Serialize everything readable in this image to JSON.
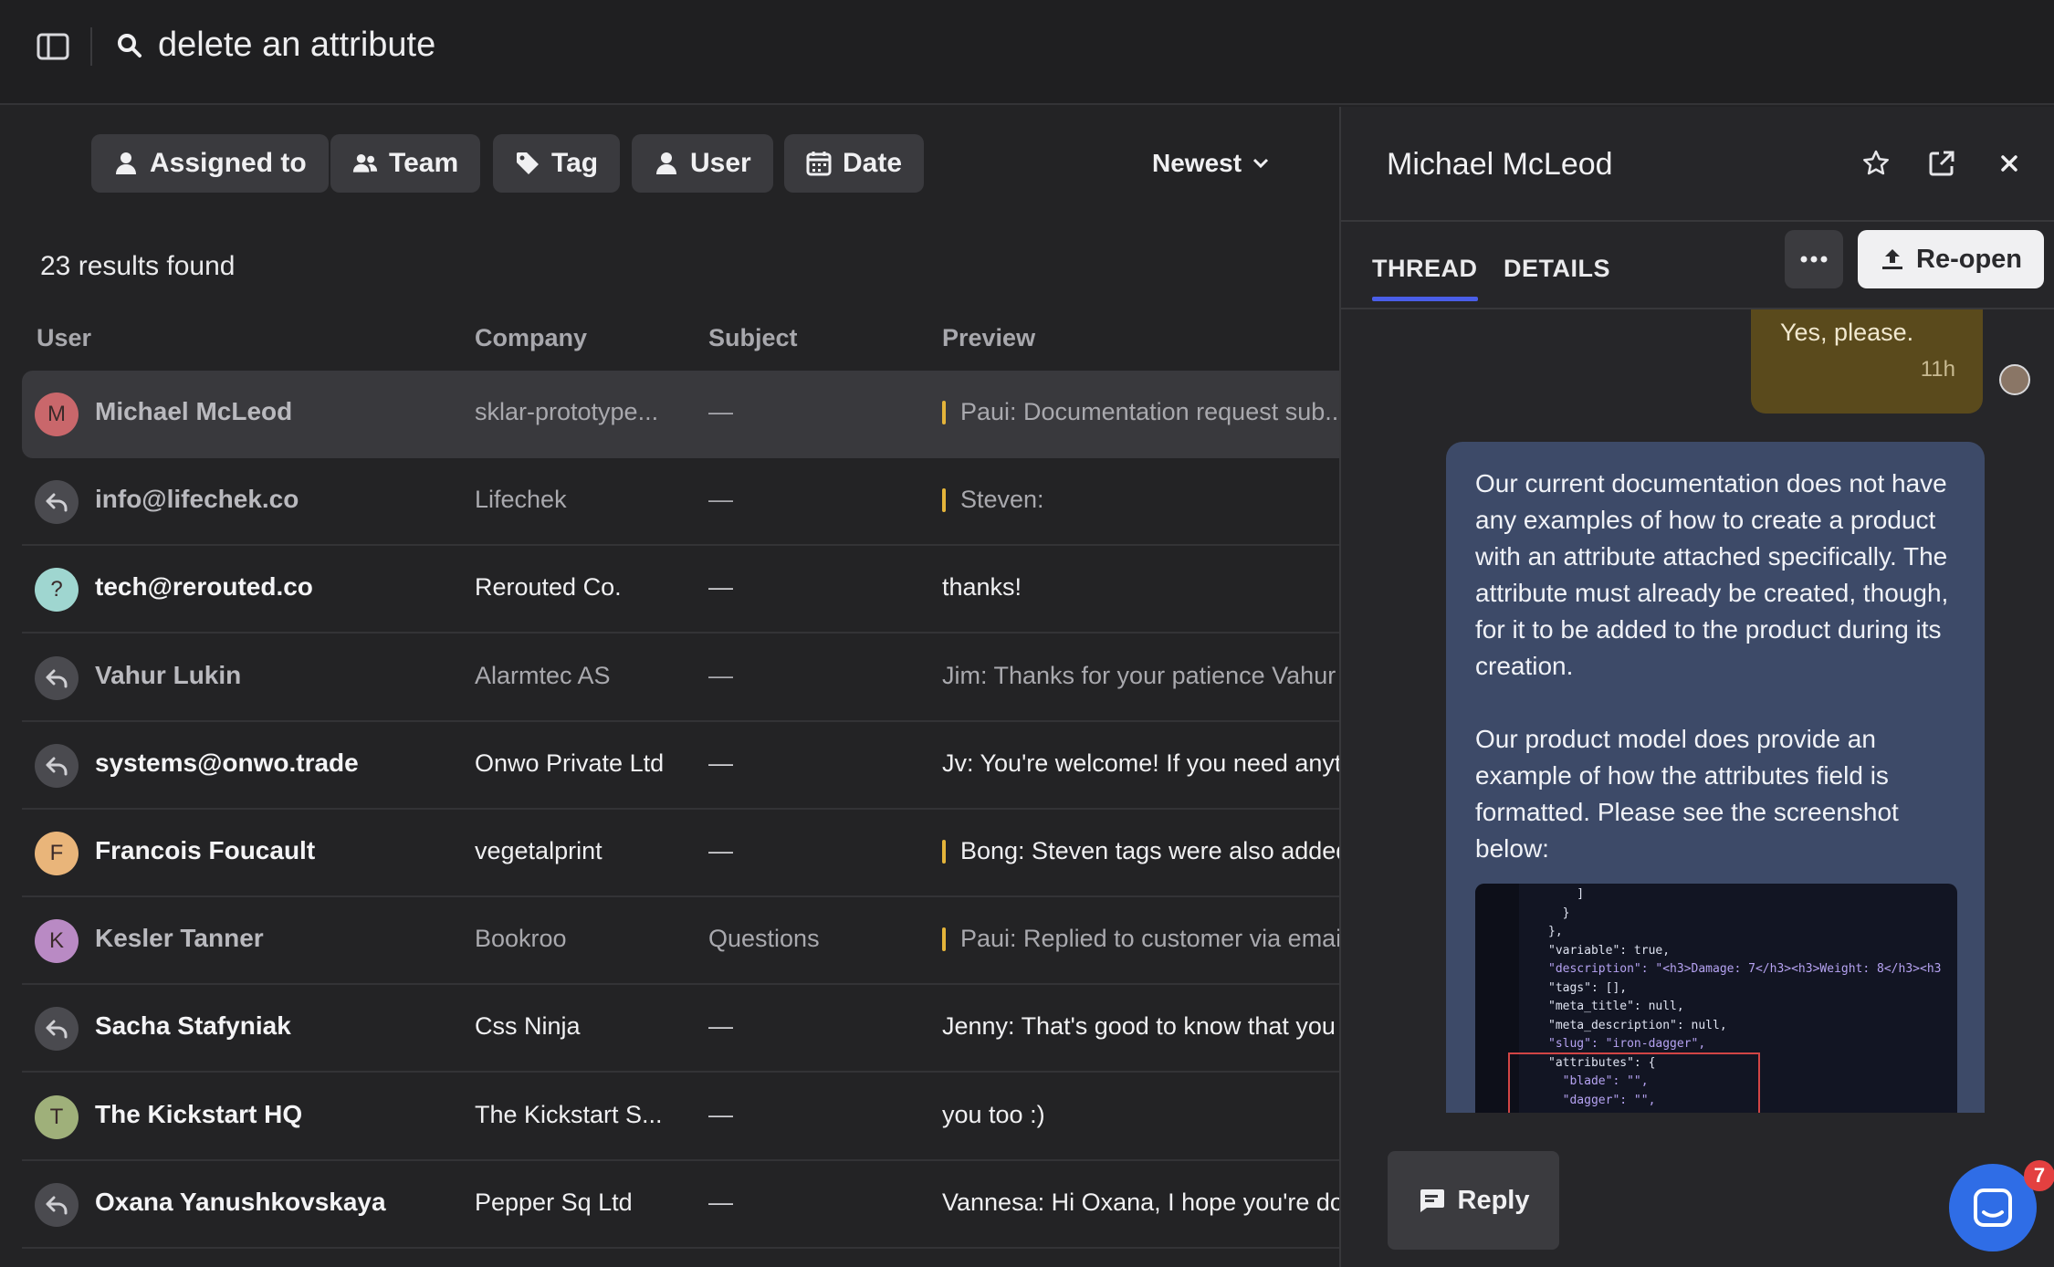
{
  "search": {
    "query": "delete an attribute"
  },
  "filters": [
    {
      "label": "Assigned to",
      "icon": "person-icon"
    },
    {
      "label": "Team",
      "icon": "people-icon"
    },
    {
      "label": "Tag",
      "icon": "tag-icon"
    },
    {
      "label": "User",
      "icon": "person-icon"
    },
    {
      "label": "Date",
      "icon": "calendar-icon"
    }
  ],
  "sort": {
    "label": "Newest"
  },
  "results_text": "23 results found",
  "columns": {
    "user": "User",
    "company": "Company",
    "subject": "Subject",
    "preview": "Preview"
  },
  "rows": [
    {
      "avatar": "M",
      "avatar_color": "#c9676b",
      "user": "Michael McLeod",
      "company": "sklar-prototype...",
      "subject": "—",
      "preview": "Paui: Documentation request sub...",
      "flag": true
    },
    {
      "avatar": "",
      "user": "info@lifechek.co",
      "company": "Lifechek",
      "subject": "—",
      "preview": "Steven:",
      "flag": true
    },
    {
      "avatar": "?",
      "avatar_color": "#9fd6d0",
      "user": "tech@rerouted.co",
      "company": "Rerouted Co.",
      "subject": "—",
      "preview": "thanks!",
      "flag": false
    },
    {
      "avatar": "",
      "user": "Vahur Lukin",
      "company": "Alarmtec AS",
      "subject": "—",
      "preview": "Jim: Thanks for your patience Vahur",
      "flag": false
    },
    {
      "avatar": "",
      "user": "systems@onwo.trade",
      "company": "Onwo Private Ltd",
      "subject": "—",
      "preview": "Jv: You're welcome! If you need anyt",
      "flag": false
    },
    {
      "avatar": "F",
      "avatar_color": "#e9b57a",
      "user": "Francois Foucault",
      "company": "vegetalprint",
      "subject": "—",
      "preview": "Bong: Steven tags were also added",
      "flag": true
    },
    {
      "avatar": "K",
      "avatar_color": "#b98ac4",
      "user": "Kesler Tanner",
      "company": "Bookroo",
      "subject": "Questions",
      "preview": "Paui: Replied to customer via email",
      "flag": true
    },
    {
      "avatar": "",
      "user": "Sacha Stafyniak",
      "company": "Css Ninja",
      "subject": "—",
      "preview": "Jenny: That's good to know that you",
      "flag": false
    },
    {
      "avatar": "T",
      "avatar_color": "#9fb07a",
      "user": "The Kickstart HQ",
      "company": "The Kickstart S...",
      "subject": "—",
      "preview": "you too :)",
      "flag": false
    },
    {
      "avatar": "",
      "user": "Oxana Yanushkovskaya",
      "company": "Pepper Sq Ltd",
      "subject": "—",
      "preview": "Vannesa: Hi Oxana, I hope you're doi",
      "flag": false
    }
  ],
  "panel": {
    "name": "Michael McLeod",
    "tabs": [
      "THREAD",
      "DETAILS"
    ],
    "reopen_label": "Re-open",
    "my_message": {
      "text": "Yes, please.",
      "time": "11h"
    },
    "agent_message": {
      "p1": "Our current documentation does not have any examples of how to create a product with an attribute attached specifically. The attribute must already be created, though, for it to be added to the product during its creation.",
      "p2": "Our product model does provide an example of how the attributes field is formatted. Please see the screenshot below:"
    },
    "code_lines": [
      "    ]",
      "  }",
      "},",
      "\"variable\": true,",
      "\"description\": \"<h3>Damage: 7</h3><h3>Weight: 8</h3><h3",
      "\"tags\": [],",
      "\"meta_title\": null,",
      "\"meta_description\": null,",
      "\"slug\": \"iron-dagger\",",
      "\"attributes\": {",
      "  \"blade\": \"\",",
      "  \"dagger\": \"\","
    ],
    "reply_label": "Reply",
    "chat_badge": "7"
  }
}
